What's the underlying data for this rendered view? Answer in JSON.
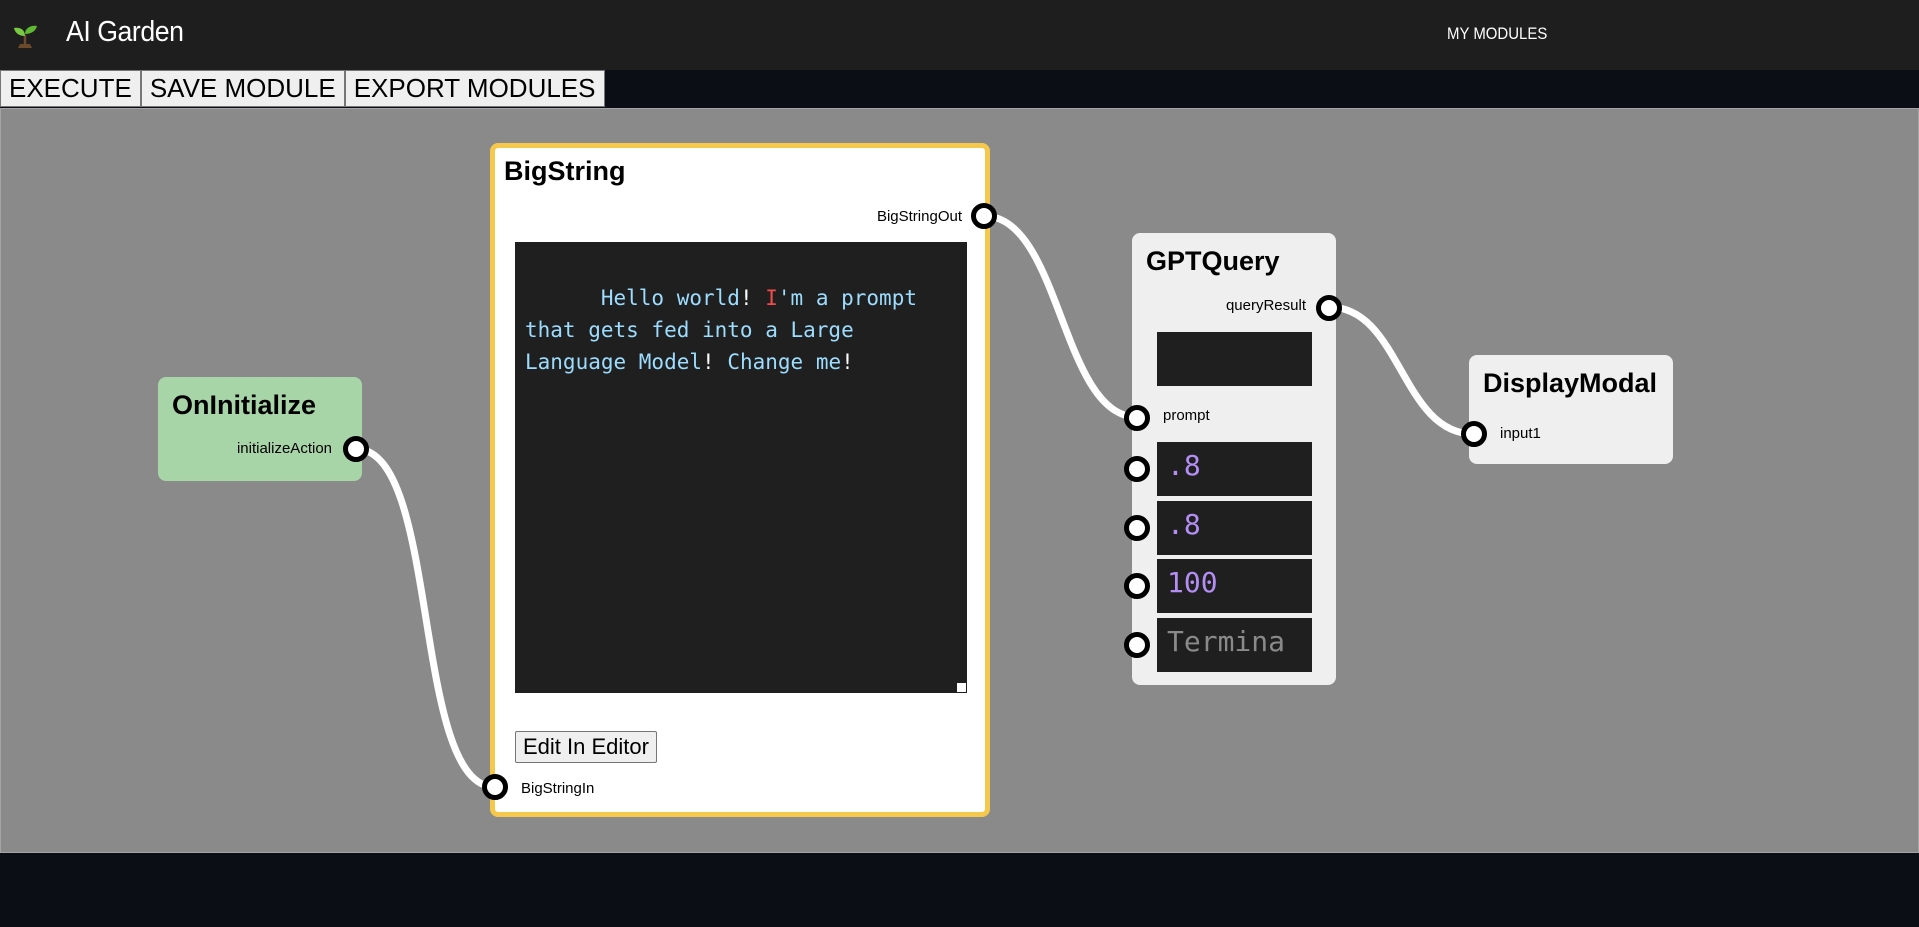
{
  "header": {
    "app_title": "AI Garden",
    "logo_icon": "sprout-icon",
    "nav": {
      "my_modules": "MY MODULES"
    }
  },
  "toolbar": {
    "execute": "EXECUTE",
    "save_module": "SAVE MODULE",
    "export_modules": "EXPORT MODULES"
  },
  "nodes": {
    "on_initialize": {
      "title": "OnInitialize",
      "outputs": [
        "initializeAction"
      ],
      "color": "#a8d5a8"
    },
    "big_string": {
      "title": "BigString",
      "output": "BigStringOut",
      "input": "BigStringIn",
      "text": "Hello world! I'm a prompt that gets fed into a Large Language Model! Change me!",
      "edit_button": "Edit In Editor",
      "border_color": "#f5c84c"
    },
    "gpt_query": {
      "title": "GPTQuery",
      "output": "queryResult",
      "input": "prompt",
      "fields": [
        {
          "value": ""
        },
        {
          "value": ".8"
        },
        {
          "value": ".8"
        },
        {
          "value": "100"
        },
        {
          "placeholder": "Termina"
        }
      ]
    },
    "display_modal": {
      "title": "DisplayModal",
      "input": "input1"
    }
  },
  "colors": {
    "header_bg": "#1e1e1e",
    "canvas_bg": "#8a8a8a",
    "page_bg": "#0b0e15",
    "code_string": "#9cdcfe",
    "field_number": "#b48ef5"
  }
}
